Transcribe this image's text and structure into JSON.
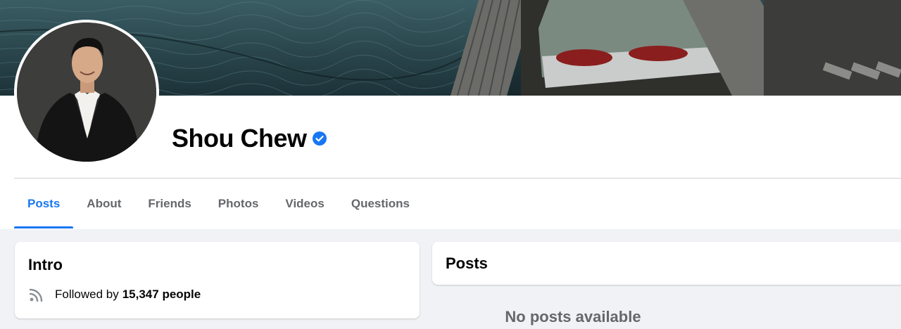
{
  "profile": {
    "name": "Shou Chew",
    "verified": true
  },
  "tabs": [
    {
      "label": "Posts",
      "active": true
    },
    {
      "label": "About",
      "active": false
    },
    {
      "label": "Friends",
      "active": false
    },
    {
      "label": "Photos",
      "active": false
    },
    {
      "label": "Videos",
      "active": false
    },
    {
      "label": "Questions",
      "active": false
    }
  ],
  "intro": {
    "title": "Intro",
    "followed_prefix": "Followed by",
    "followed_count": "15,347 people",
    "icon": "rss-icon"
  },
  "posts": {
    "title": "Posts",
    "empty_message": "No posts available"
  },
  "colors": {
    "accent": "#1877f2",
    "background": "#f0f2f5",
    "muted_text": "#65676b"
  }
}
